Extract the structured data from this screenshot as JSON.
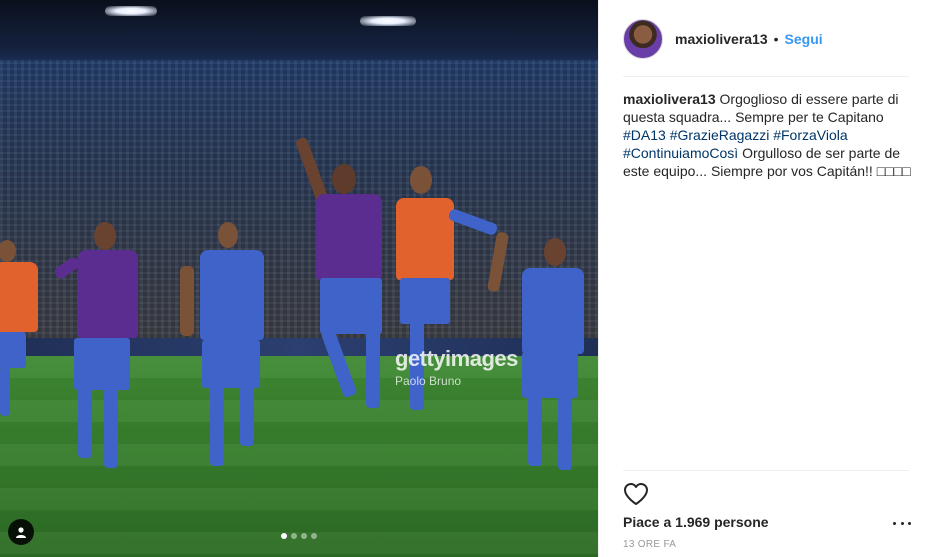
{
  "post": {
    "username": "maxiolivera13",
    "separator": "•",
    "follow_label": "Segui",
    "caption": {
      "username": "maxiolivera13",
      "line_1": "Orgoglioso di essere parte di questa squadra... Sempre per te Capitano",
      "hashtags": [
        "#DA13",
        "#GrazieRagazzi",
        "#ForzaViola",
        "#ContinuiamoCosì"
      ],
      "line_2": "Orgulloso de ser parte de este equipo... Siempre por vos Capitán!! □□□□"
    },
    "likes": "Piace a 1.969 persone",
    "timestamp": "13 ORE FA",
    "watermark": {
      "brand": "gettyimages",
      "credit": "Paolo Bruno"
    },
    "carousel": {
      "count": 4,
      "active_index": 0
    }
  },
  "icons": {
    "heart": "heart-icon",
    "more": "more-options-icon",
    "user_tag": "user-tag-icon"
  },
  "colors": {
    "link_blue": "#3897f0",
    "hashtag_blue": "#003569",
    "text": "#262626",
    "muted": "#999999",
    "fiorentina_purple": "#5b2d91",
    "away_blue": "#3f63c9"
  }
}
